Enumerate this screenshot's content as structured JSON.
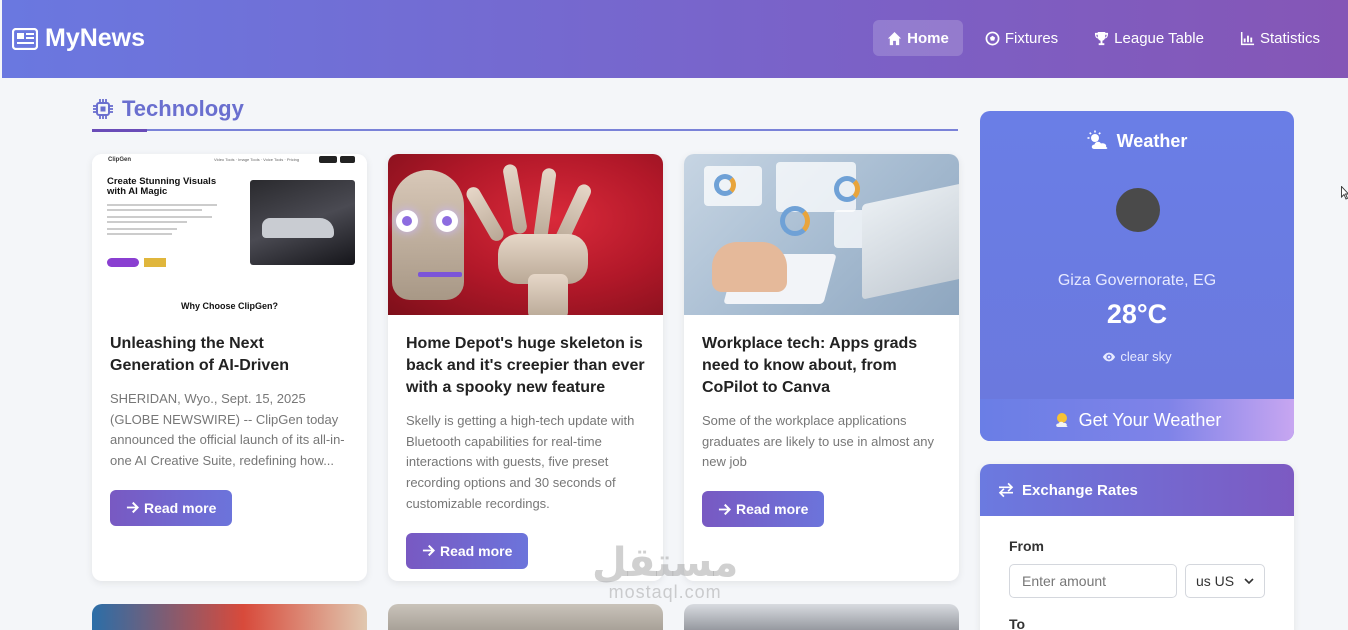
{
  "header": {
    "brand": "MyNews",
    "nav": [
      {
        "label": "Home",
        "icon": "home-icon",
        "active": true
      },
      {
        "label": "Fixtures",
        "icon": "soccer-ball-icon",
        "active": false
      },
      {
        "label": "League Table",
        "icon": "trophy-icon",
        "active": false
      },
      {
        "label": "Statistics",
        "icon": "chart-icon",
        "active": false
      }
    ]
  },
  "section": {
    "title": "Technology",
    "icon": "chip-icon"
  },
  "articles": [
    {
      "title": "Unleashing the Next Generation of AI-Driven",
      "summary": "SHERIDAN, Wyo., Sept. 15, 2025 (GLOBE NEWSWIRE) -- ClipGen today announced the official launch of its all-in-one AI Creative Suite, redefining how...",
      "read_more": "Read more",
      "image": {
        "logo": "ClipGen",
        "links": "Video Tools · Image Tools · Voice Tools · Pricing",
        "headline": "Create Stunning Visuals with AI Magic",
        "footer": "Why Choose ClipGen?"
      }
    },
    {
      "title": "Home Depot's huge skeleton is back and it's creepier than ever with a spooky new feature",
      "summary": "Skelly is getting a high-tech update with Bluetooth capabilities for real-time interactions with guests, five preset recording options and 30 seconds of customizable recordings.",
      "read_more": "Read more"
    },
    {
      "title": "Workplace tech: Apps grads need to know about, from CoPilot to Canva",
      "summary": "Some of the workplace applications graduates are likely to use in almost any new job",
      "read_more": "Read more"
    }
  ],
  "weather": {
    "title": "Weather",
    "location": "Giza Governorate, EG",
    "temperature": "28°C",
    "description": "clear sky",
    "button": "Get Your Weather"
  },
  "exchange": {
    "title": "Exchange Rates",
    "from_label": "From",
    "amount_placeholder": "Enter amount",
    "currency": "us US",
    "to_label": "To"
  },
  "watermark": {
    "arabic": "مستقل",
    "latin": "mostaql.com"
  },
  "colors": {
    "header_start": "#6a78e0",
    "header_end": "#8556b6",
    "accent": "#6a6fcf",
    "button": "#7859c2"
  }
}
